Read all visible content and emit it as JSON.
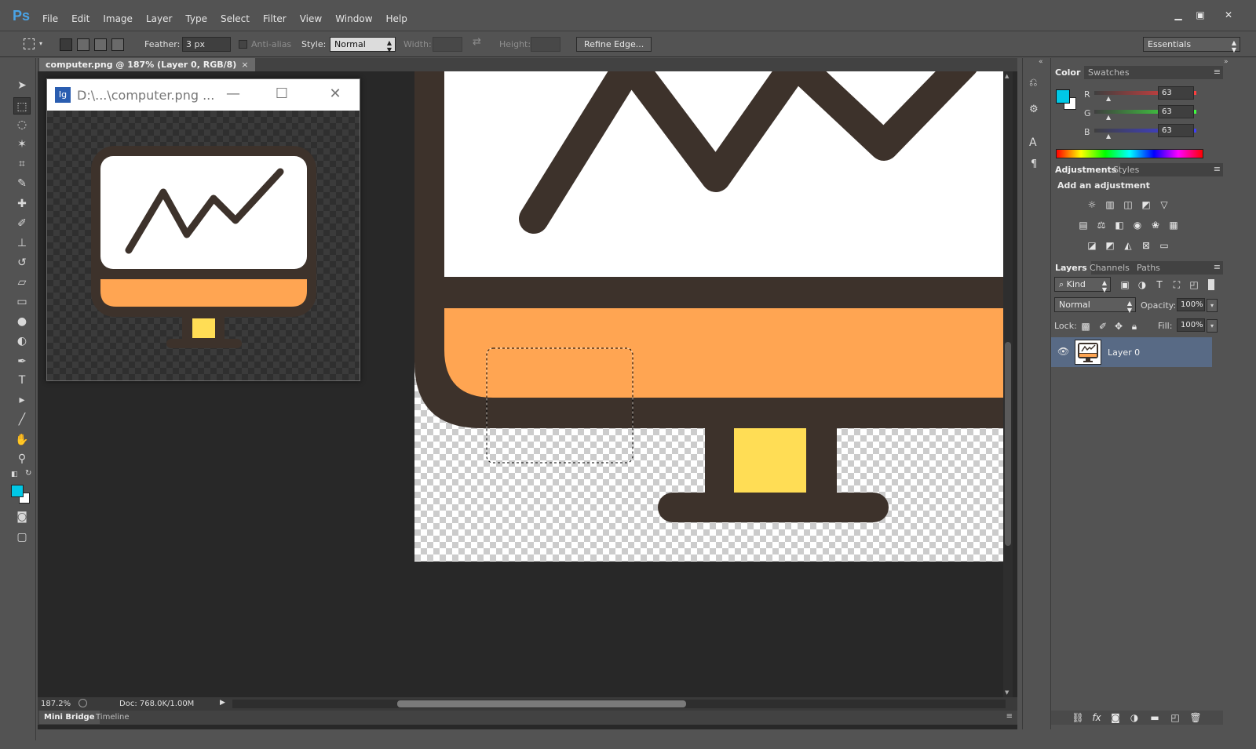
{
  "app": {
    "logo": "Ps"
  },
  "menu": [
    "File",
    "Edit",
    "Image",
    "Layer",
    "Type",
    "Select",
    "Filter",
    "View",
    "Window",
    "Help"
  ],
  "options": {
    "feather_label": "Feather:",
    "feather_value": "3 px",
    "antialias_label": "Anti-alias",
    "style_label": "Style:",
    "style_value": "Normal",
    "width_label": "Width:",
    "height_label": "Height:",
    "refine_edge": "Refine Edge...",
    "workspace": "Essentials"
  },
  "document": {
    "tab_title": "computer.png @ 187% (Layer 0, RGB/8)",
    "tab_close": "×",
    "zoom": "187.2%",
    "doc_size": "Doc: 768.0K/1.00M"
  },
  "bottom_tabs": [
    "Mini Bridge",
    "Timeline"
  ],
  "preview_window": {
    "title": "D:\\...\\computer.png ...",
    "app_icon": "Ig"
  },
  "color_panel": {
    "tabs": [
      "Color",
      "Swatches"
    ],
    "channels": [
      {
        "label": "R",
        "value": "63"
      },
      {
        "label": "G",
        "value": "63"
      },
      {
        "label": "B",
        "value": "63"
      }
    ],
    "foreground": "#00c8e6",
    "background": "#ffffff"
  },
  "adjustments_panel": {
    "tabs": [
      "Adjustments",
      "Styles"
    ],
    "heading": "Add an adjustment"
  },
  "layers_panel": {
    "tabs": [
      "Layers",
      "Channels",
      "Paths"
    ],
    "kind_filter": "Kind",
    "blend_mode": "Normal",
    "opacity_label": "Opacity:",
    "opacity_value": "100%",
    "lock_label": "Lock:",
    "fill_label": "Fill:",
    "fill_value": "100%",
    "layers": [
      {
        "name": "Layer 0"
      }
    ]
  },
  "image_colors": {
    "outline": "#3d322b",
    "screen": "#ffffff",
    "bezel_bottom": "#ffa552",
    "stand_square": "#ffdd55"
  }
}
